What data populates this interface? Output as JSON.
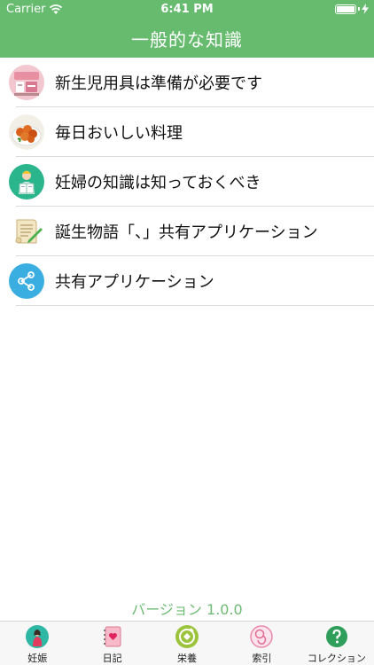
{
  "status_bar": {
    "carrier": "Carrier",
    "time": "6:41 PM"
  },
  "header": {
    "title": "一般的な知識"
  },
  "items": [
    {
      "label": "新生児用具は準備が必要です",
      "icon": "baby-supplies-icon"
    },
    {
      "label": "毎日おいしい料理",
      "icon": "food-icon"
    },
    {
      "label": "妊婦の知識は知っておくべき",
      "icon": "pregnant-reader-icon"
    },
    {
      "label": "誕生物語「、」共有アプリケーション",
      "icon": "paper-pen-icon"
    },
    {
      "label": "共有アプリケーション",
      "icon": "share-icon"
    }
  ],
  "version": "バージョン 1.0.0",
  "tabs": [
    {
      "label": "妊娠",
      "icon": "pregnant-woman-icon"
    },
    {
      "label": "日記",
      "icon": "diary-icon"
    },
    {
      "label": "栄養",
      "icon": "nutrition-icon"
    },
    {
      "label": "索引",
      "icon": "fetus-icon"
    },
    {
      "label": "コレクション",
      "icon": "help-icon"
    }
  ],
  "colors": {
    "header": "#66bb6e",
    "version_text": "#6dbb74",
    "share_blue": "#3aaee0",
    "help_green": "#2e9e5a"
  }
}
